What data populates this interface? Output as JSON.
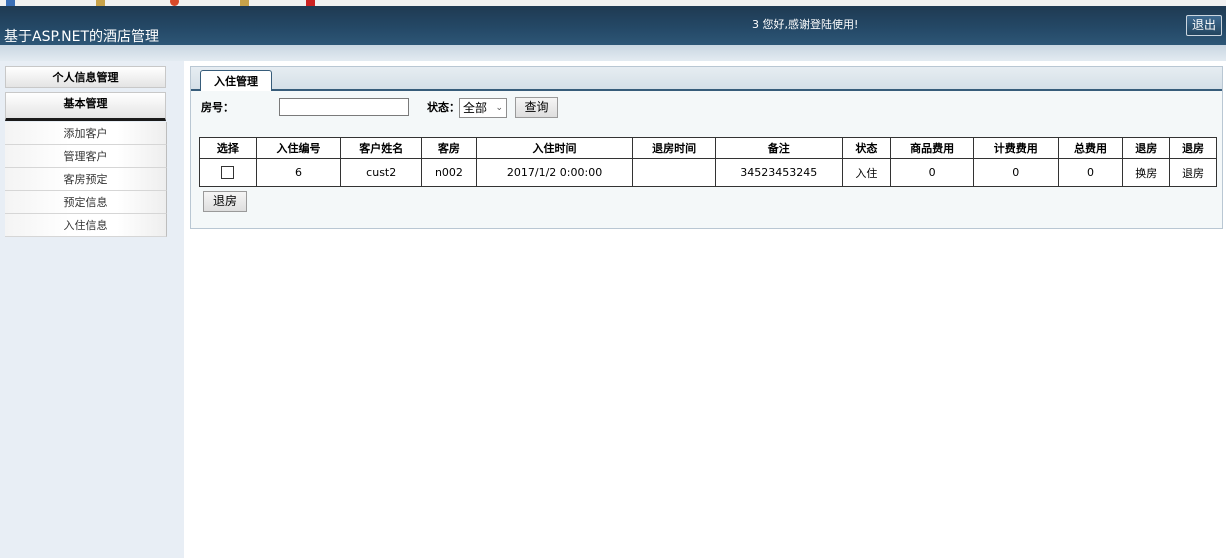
{
  "header": {
    "app_title": "基于ASP.NET的酒店管理",
    "welcome_text": "3 您好,感谢登陆使用!",
    "logout_label": "退出"
  },
  "sidebar": {
    "sections": [
      {
        "label": "个人信息管理"
      },
      {
        "label": "基本管理"
      }
    ],
    "items": [
      {
        "label": "添加客户"
      },
      {
        "label": "管理客户"
      },
      {
        "label": "客房预定"
      },
      {
        "label": "预定信息"
      },
      {
        "label": "入住信息"
      }
    ]
  },
  "main": {
    "tab_label": "入住管理",
    "search": {
      "room_label": "房号：",
      "room_value": "",
      "status_label": "状态：",
      "status_value": "全部",
      "query_button": "查询"
    },
    "table": {
      "columns": [
        "选择",
        "入住编号",
        "客户姓名",
        "客房",
        "入住时间",
        "退房时间",
        "备注",
        "状态",
        "商品费用",
        "计费费用",
        "总费用",
        "退房",
        "退房"
      ],
      "rows": [
        {
          "id": "6",
          "customer": "cust2",
          "room": "n002",
          "checkin_time": "2017/1/2 0:00:00",
          "checkout_time": "",
          "remark": "34523453245",
          "status": "入住",
          "goods_fee": "0",
          "billing_fee": "0",
          "total_fee": "0",
          "change_room": "换房",
          "checkout": "退房"
        }
      ]
    },
    "checkout_button": "退房"
  }
}
